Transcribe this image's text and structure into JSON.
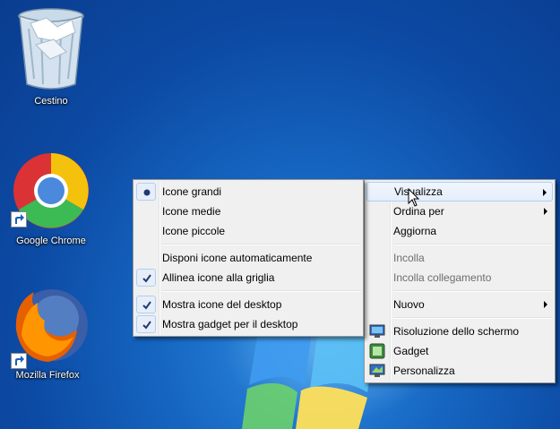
{
  "desktop": {
    "icons": [
      {
        "label": "Cestino",
        "icon": "recycle-bin-icon"
      },
      {
        "label": "Google Chrome",
        "icon": "chrome-icon"
      },
      {
        "label": "Mozilla Firefox",
        "icon": "firefox-icon"
      }
    ]
  },
  "context_menu": {
    "items": [
      {
        "label": "Visualizza",
        "submenu": true,
        "highlighted": true
      },
      {
        "label": "Ordina per",
        "submenu": true
      },
      {
        "label": "Aggiorna"
      },
      {
        "label": "Incolla",
        "disabled": true
      },
      {
        "label": "Incolla collegamento",
        "disabled": true
      },
      {
        "label": "Nuovo",
        "submenu": true
      },
      {
        "label": "Risoluzione dello schermo",
        "icon": "screen-resolution-icon"
      },
      {
        "label": "Gadget",
        "icon": "gadget-icon"
      },
      {
        "label": "Personalizza",
        "icon": "personalize-icon"
      }
    ]
  },
  "view_submenu": {
    "items": [
      {
        "label": "Icone grandi",
        "state": "radio-selected"
      },
      {
        "label": "Icone medie"
      },
      {
        "label": "Icone piccole"
      },
      {
        "label": "Disponi icone automaticamente"
      },
      {
        "label": "Allinea icone alla griglia",
        "state": "checked"
      },
      {
        "label": "Mostra icone del desktop",
        "state": "checked"
      },
      {
        "label": "Mostra gadget per il desktop",
        "state": "checked"
      }
    ]
  },
  "colors": {
    "desktop_background": "#1565c0",
    "menu_background": "#f0f0f0",
    "highlight_border": "#aecff7"
  }
}
